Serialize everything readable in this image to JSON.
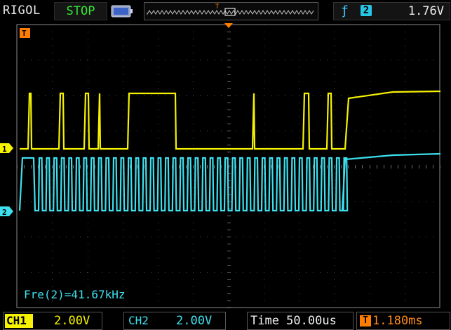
{
  "header": {
    "brand": "RIGOL",
    "run_state": "STOP",
    "trigger": {
      "edge_symbol": "ƒ",
      "source": "2",
      "level": "1.76V"
    },
    "trigger_position_marker": "T"
  },
  "markers": {
    "trigger_marker": "T",
    "ch1_ground": "1",
    "ch2_ground": "2"
  },
  "measurement": {
    "text": "Fre(2)=41.67kHz"
  },
  "footer": {
    "ch1_label": "CH1",
    "ch1_scale": "2.00V",
    "ch2_label": "CH2",
    "ch2_scale": "2.00V",
    "timebase": "Time 50.00us",
    "trigger_delay_icon": "T",
    "trigger_delay": "1.180ms"
  },
  "colors": {
    "ch1": "#f6f200",
    "ch2": "#3ee0ee",
    "trigger": "#ff7d00",
    "run_state": "#34e634"
  },
  "icons": {
    "battery": "battery-icon",
    "trigger_edge": "rising-edge-icon"
  }
}
